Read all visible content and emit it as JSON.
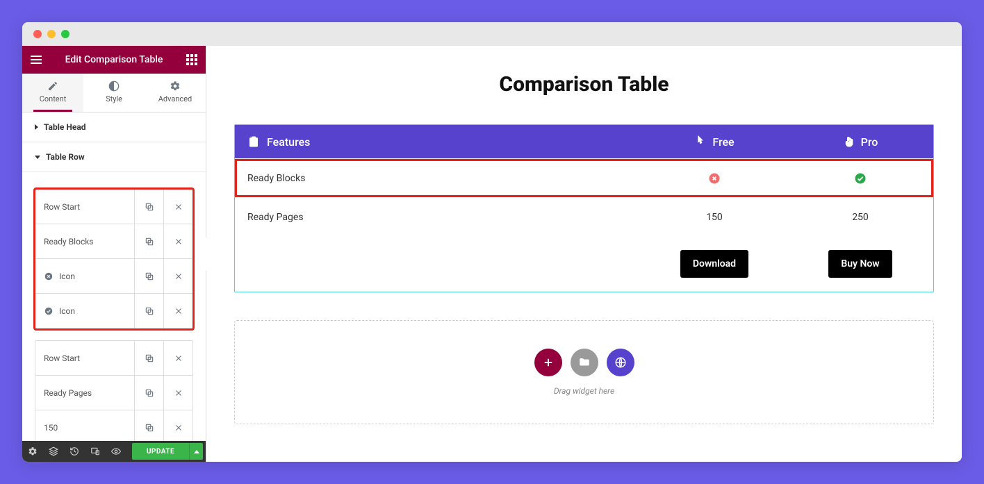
{
  "sidebar": {
    "title": "Edit Comparison Table",
    "tabs": {
      "content": "Content",
      "style": "Style",
      "advanced": "Advanced"
    },
    "sections": {
      "head": "Table Head",
      "row": "Table Row"
    },
    "rows_highlighted": [
      {
        "label": "Row Start",
        "icon": null
      },
      {
        "label": "Ready Blocks",
        "icon": null
      },
      {
        "label": "Icon",
        "icon": "x"
      },
      {
        "label": "Icon",
        "icon": "check"
      }
    ],
    "rows_rest": [
      {
        "label": "Row Start",
        "icon": null
      },
      {
        "label": "Ready Pages",
        "icon": null
      },
      {
        "label": "150",
        "icon": null
      }
    ],
    "update_label": "UPDATE"
  },
  "canvas": {
    "title": "Comparison Table",
    "headers": {
      "features": "Features",
      "free": "Free",
      "pro": "Pro"
    },
    "rows": [
      {
        "feature": "Ready Blocks",
        "free": "x-icon",
        "pro": "check-icon",
        "highlight": true
      },
      {
        "feature": "Ready Pages",
        "free": "150",
        "pro": "250",
        "highlight": false
      }
    ],
    "buttons": {
      "free": "Download",
      "pro": "Buy Now"
    },
    "dropzone_text": "Drag widget here"
  }
}
